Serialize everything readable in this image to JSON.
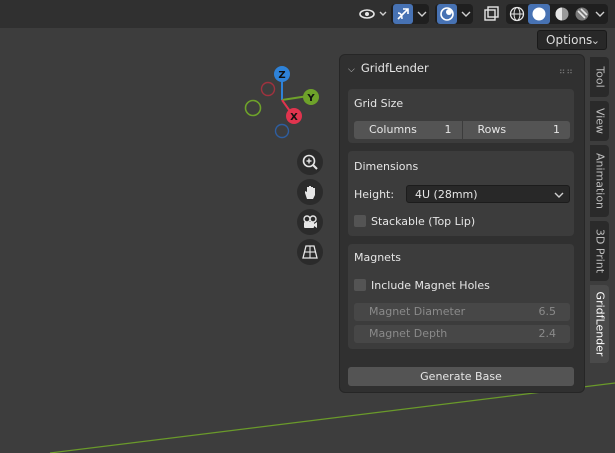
{
  "header": {
    "options_label": "Options"
  },
  "gizmo": {
    "z_label": "Z",
    "y_label": "Y",
    "x_label": "X",
    "colors": {
      "x": "#e0344e",
      "y": "#6ea22a",
      "z": "#2e82d8"
    }
  },
  "panel": {
    "title": "GridfLender",
    "grid_size": {
      "title": "Grid Size",
      "columns_label": "Columns",
      "columns_value": "1",
      "rows_label": "Rows",
      "rows_value": "1"
    },
    "dimensions": {
      "title": "Dimensions",
      "height_label": "Height:",
      "height_value": "4U (28mm)",
      "stackable_label": "Stackable (Top Lip)"
    },
    "magnets": {
      "title": "Magnets",
      "include_label": "Include Magnet Holes",
      "diameter_label": "Magnet Diameter",
      "diameter_value": "6.5",
      "depth_label": "Magnet Depth",
      "depth_value": "2.4"
    },
    "generate_label": "Generate Base"
  },
  "tabs": [
    {
      "label": "Tool"
    },
    {
      "label": "View"
    },
    {
      "label": "Animation"
    },
    {
      "label": "3D Print"
    },
    {
      "label": "GridfLender"
    }
  ]
}
